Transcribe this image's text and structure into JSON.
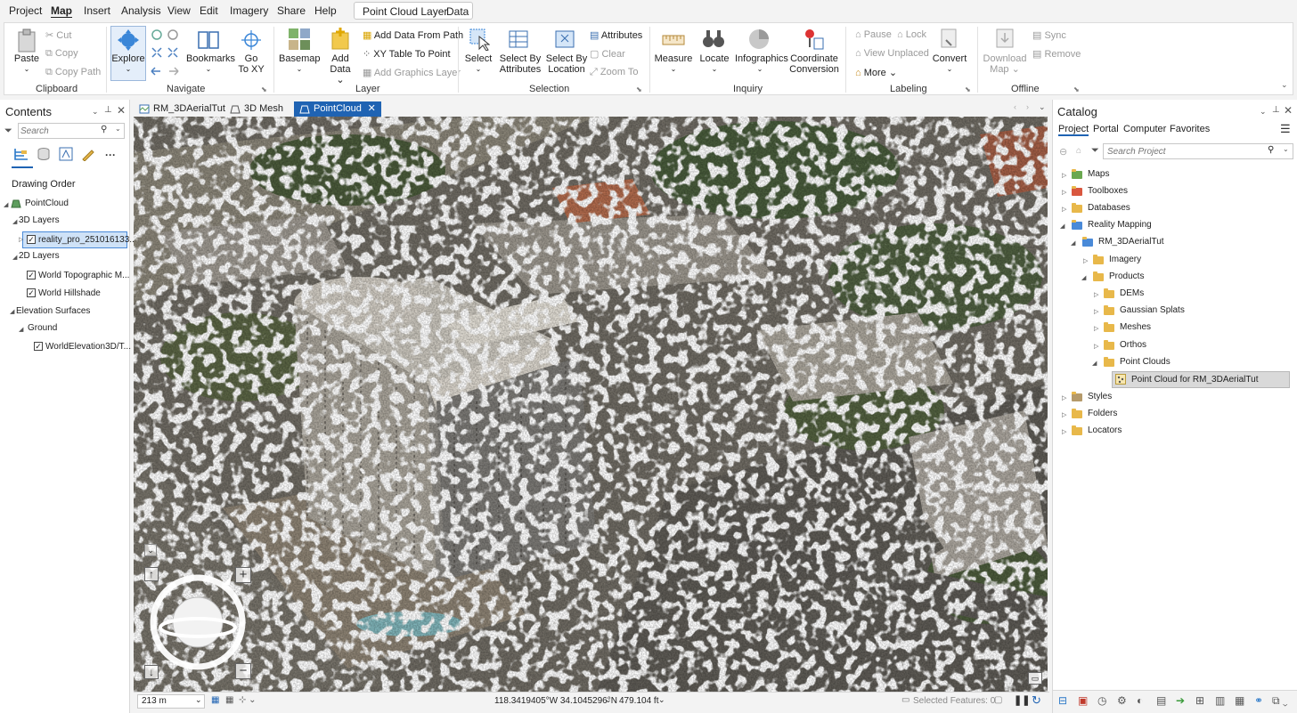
{
  "menu": {
    "items": [
      "Project",
      "Map",
      "Insert",
      "Analysis",
      "View",
      "Edit",
      "Imagery",
      "Share",
      "Help"
    ],
    "active": "Map",
    "contextual_tabs": [
      "Point Cloud Layer",
      "Data"
    ]
  },
  "ribbon": {
    "clipboard": {
      "paste": "Paste",
      "cut": "Cut",
      "copy": "Copy",
      "copy_path": "Copy Path",
      "label": "Clipboard"
    },
    "navigate": {
      "explore": "Explore",
      "bookmarks": "Bookmarks",
      "go_to_xy_1": "Go",
      "go_to_xy_2": "To XY",
      "label": "Navigate"
    },
    "layer": {
      "basemap": "Basemap",
      "add_data_1": "Add",
      "add_data_2": "Data",
      "add_data_from_path": "Add Data From Path",
      "xy_table_to_point": "XY Table To Point",
      "add_graphics_layer": "Add Graphics Layer",
      "label": "Layer"
    },
    "selection": {
      "select": "Select",
      "select_by_attributes_1": "Select By",
      "select_by_attributes_2": "Attributes",
      "select_by_location_1": "Select By",
      "select_by_location_2": "Location",
      "attributes": "Attributes",
      "clear": "Clear",
      "zoom_to": "Zoom To",
      "label": "Selection"
    },
    "inquiry": {
      "measure": "Measure",
      "locate": "Locate",
      "infographics": "Infographics",
      "coordinate_conversion_1": "Coordinate",
      "coordinate_conversion_2": "Conversion",
      "label": "Inquiry"
    },
    "labeling": {
      "pause": "Pause",
      "lock": "Lock",
      "view_unplaced": "View Unplaced",
      "more": "More",
      "convert": "Convert",
      "label": "Labeling"
    },
    "offline": {
      "download_map_1": "Download",
      "download_map_2": "Map",
      "sync": "Sync",
      "remove": "Remove",
      "label": "Offline"
    }
  },
  "contents": {
    "title": "Contents",
    "search_placeholder": "Search",
    "drawing_order": "Drawing Order",
    "map_name": "PointCloud",
    "layers_3d": "3D Layers",
    "layer_reality": "reality_pro_251016133...",
    "layers_2d": "2D Layers",
    "layer_topo": "World Topographic M...",
    "layer_hillshade": "World Hillshade",
    "elevation_surfaces": "Elevation Surfaces",
    "ground": "Ground",
    "layer_elevation": "WorldElevation3D/T..."
  },
  "doc_tabs": [
    {
      "label": "RM_3DAerialTut",
      "active": false
    },
    {
      "label": "3D Mesh",
      "active": false
    },
    {
      "label": "PointCloud",
      "active": true
    }
  ],
  "statusbar": {
    "scale": "213 m",
    "coords": "118.3419405°W 34.1045296°N",
    "elevation": "479.104 ft",
    "selected_features": "Selected Features: 0"
  },
  "catalog": {
    "title": "Catalog",
    "tabs": [
      "Project",
      "Portal",
      "Computer",
      "Favorites"
    ],
    "active_tab": "Project",
    "search_placeholder": "Search Project",
    "items": {
      "maps": "Maps",
      "toolboxes": "Toolboxes",
      "databases": "Databases",
      "reality_mapping": "Reality Mapping",
      "rm_3daerialtut": "RM_3DAerialTut",
      "imagery": "Imagery",
      "products": "Products",
      "dems": "DEMs",
      "gaussian_splats": "Gaussian Splats",
      "meshes": "Meshes",
      "orthos": "Orthos",
      "point_clouds": "Point Clouds",
      "point_cloud_item": "Point Cloud for RM_3DAerialTut",
      "styles": "Styles",
      "folders": "Folders",
      "locators": "Locators"
    }
  },
  "colors": {
    "accent": "#1f63b3",
    "folder": "#e8b84a",
    "selected_row": "#d9d9d9"
  }
}
